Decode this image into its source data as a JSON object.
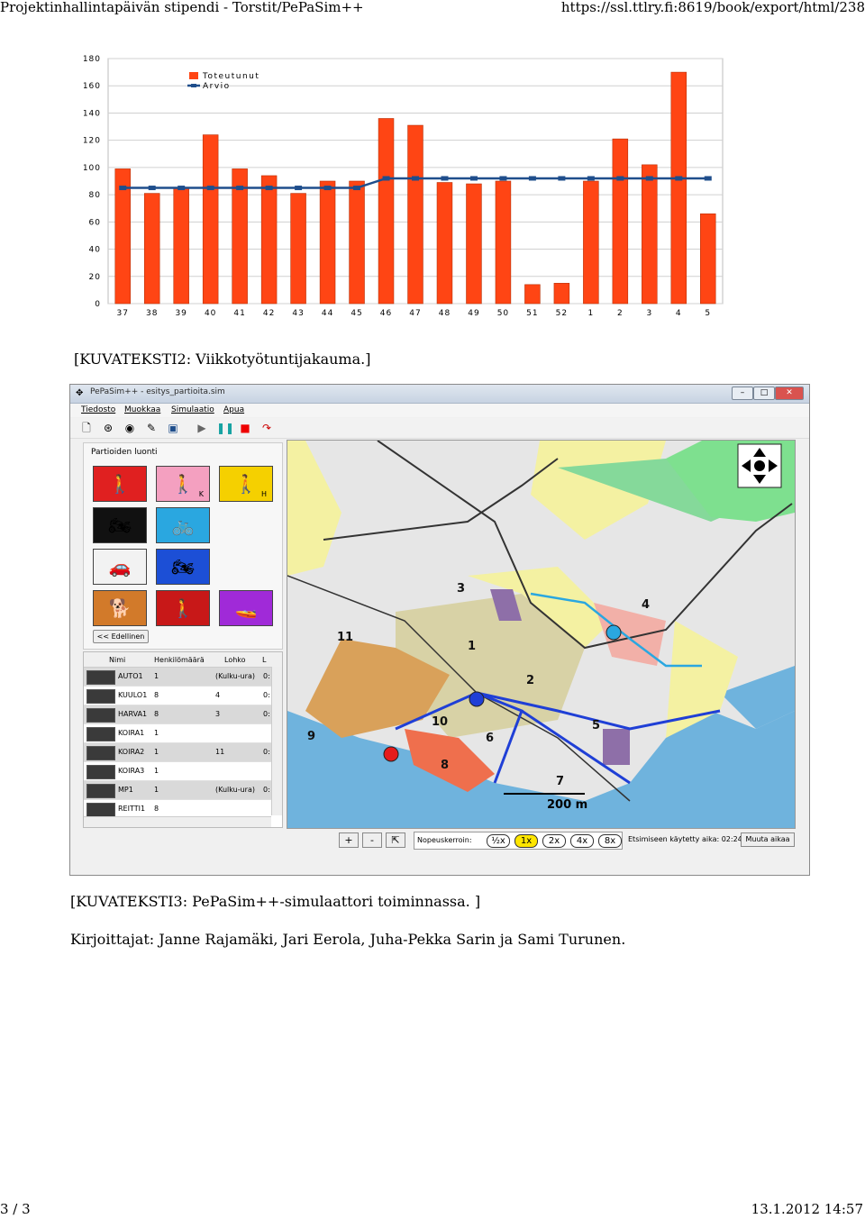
{
  "header": {
    "title": "Projektinhallintapäivän stipendi - Torstit/PePaSim++",
    "url": "https://ssl.ttlry.fi:8619/book/export/html/238"
  },
  "footer": {
    "page": "3 / 3",
    "date": "13.1.2012 14:57"
  },
  "caption2": "[KUVATEKSTI2: Viikkotyötuntijakauma.]",
  "caption3": "[KUVATEKSTI3: PePaSim++-simulaattori toiminnassa. ]",
  "authors": "Kirjoittajat: Janne Rajamäki, Jari Eerola, Juha-Pekka Sarin ja Sami Turunen.",
  "colors": {
    "bar": "#ff4514",
    "line": "#1f4e8c",
    "grid": "#d0d0d0"
  },
  "chart_data": {
    "type": "bar",
    "categories": [
      "37",
      "38",
      "39",
      "40",
      "41",
      "42",
      "43",
      "44",
      "45",
      "46",
      "47",
      "48",
      "49",
      "50",
      "51",
      "52",
      "1",
      "2",
      "3",
      "4",
      "5"
    ],
    "series": [
      {
        "name": "Toteutunut",
        "type": "bar",
        "values": [
          99,
          81,
          85,
          124,
          99,
          94,
          81,
          90,
          90,
          136,
          131,
          89,
          88,
          90,
          14,
          15,
          90,
          121,
          102,
          170,
          66
        ]
      },
      {
        "name": "Arvio",
        "type": "line",
        "values": [
          85,
          85,
          85,
          85,
          85,
          85,
          85,
          85,
          85,
          92,
          92,
          92,
          92,
          92,
          92,
          92,
          92,
          92,
          92,
          92,
          92
        ]
      }
    ],
    "yticks": [
      "0",
      "20",
      "40",
      "60",
      "80",
      "100",
      "120",
      "140",
      "160",
      "180"
    ],
    "ylim": [
      0,
      180
    ],
    "grid": true,
    "legend": "top-left"
  },
  "app": {
    "window_title": "PePaSim++ - esitys_partioita.sim",
    "menu": [
      "Tiedosto",
      "Muokkaa",
      "Simulaatio",
      "Apua"
    ],
    "panel_title": "Partioiden luonti",
    "prev_button": "<< Edellinen",
    "spawn_buttons": [
      {
        "name": "walker-red",
        "sub": "",
        "color": "#e02020",
        "glyph": "🚶"
      },
      {
        "name": "walker-pink",
        "sub": "K",
        "color": "#f4a0c0",
        "glyph": "🚶"
      },
      {
        "name": "walker-yellow",
        "sub": "H",
        "color": "#f5d000",
        "glyph": "🚶"
      },
      {
        "name": "atv",
        "sub": "",
        "color": "#111111",
        "glyph": "🏍"
      },
      {
        "name": "bicycle",
        "sub": "",
        "color": "#2aa7e0",
        "glyph": "🚲"
      },
      {
        "name": "car",
        "sub": "",
        "color": "#f2f2f2",
        "glyph": "🚗"
      },
      {
        "name": "motorcycle",
        "sub": "",
        "color": "#1c4fd6",
        "glyph": "🏍"
      },
      {
        "name": "dog",
        "sub": "",
        "color": "#d27a2a",
        "glyph": "🐕"
      },
      {
        "name": "walker-dark-red",
        "sub": "",
        "color": "#c81818",
        "glyph": "🚶"
      },
      {
        "name": "boat",
        "sub": "",
        "color": "#a02ad8",
        "glyph": "🚤"
      }
    ],
    "list_headers": [
      "Nimi",
      "Henkilömäärä",
      "Lohko",
      "L"
    ],
    "rows": [
      {
        "name": "AUTO1",
        "count": "1",
        "block": "(Kulku-ura)",
        "extra": "0:"
      },
      {
        "name": "KUULO1",
        "count": "8",
        "block": "4",
        "extra": "0:"
      },
      {
        "name": "HARVA1",
        "count": "8",
        "block": "3",
        "extra": "0:"
      },
      {
        "name": "KOIRA1",
        "count": "1",
        "block": "",
        "extra": ""
      },
      {
        "name": "KOIRA2",
        "count": "1",
        "block": "11",
        "extra": "0:"
      },
      {
        "name": "KOIRA3",
        "count": "1",
        "block": "",
        "extra": ""
      },
      {
        "name": "MP1",
        "count": "1",
        "block": "(Kulku-ura)",
        "extra": "0:"
      },
      {
        "name": "REITTI1",
        "count": "8",
        "block": "",
        "extra": ""
      }
    ],
    "map_labels": [
      "1",
      "2",
      "3",
      "4",
      "5",
      "6",
      "7",
      "8",
      "9",
      "10",
      "11"
    ],
    "scale_label": "200 m",
    "zoom_in": "+",
    "zoom_out": "-",
    "speed_label": "Nopeuskerroin:",
    "speeds": [
      "½x",
      "1x",
      "2x",
      "4x",
      "8x"
    ],
    "elapsed": "Etsimiseen käytetty aika:  02:24",
    "change_time": "Muuta aikaa"
  }
}
